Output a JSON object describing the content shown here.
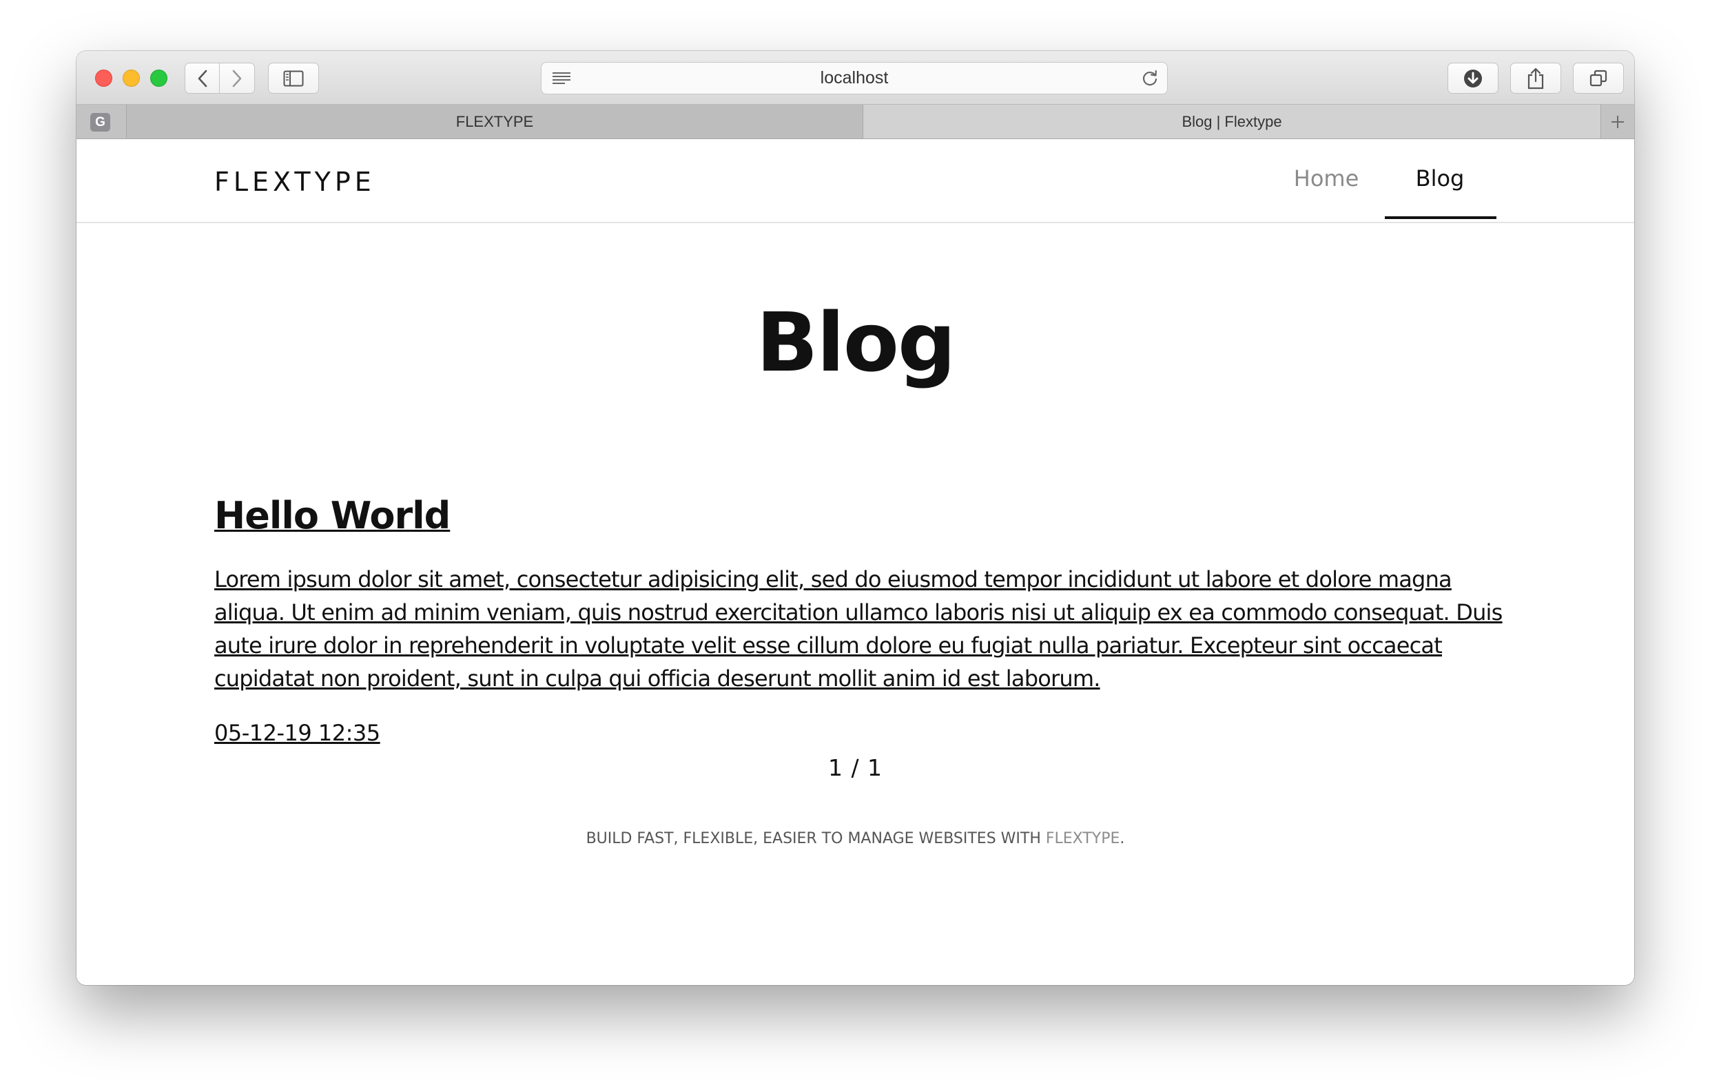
{
  "browser": {
    "url": "localhost",
    "tabs": [
      {
        "label": "FLEXTYPE",
        "favicon": "G"
      },
      {
        "label": "Blog | Flextype"
      }
    ]
  },
  "site": {
    "brand": "FLEXTYPE",
    "nav": [
      {
        "label": "Home"
      },
      {
        "label": "Blog"
      }
    ]
  },
  "page": {
    "title": "Blog",
    "post": {
      "title": "Hello World",
      "excerpt": "Lorem ipsum dolor sit amet, consectetur adipisicing elit, sed do eiusmod tempor incididunt ut labore et dolore magna aliqua. Ut enim ad minim veniam, quis nostrud exercitation ullamco laboris nisi ut aliquip ex ea commodo consequat. Duis aute irure dolor in reprehenderit in voluptate velit esse cillum dolore eu fugiat nulla pariatur. Excepteur sint occaecat cupidatat non proident, sunt in culpa qui officia deserunt mollit anim id est laborum.",
      "date": "05-12-19 12:35"
    },
    "pagination": "1 / 1"
  },
  "footer": {
    "text": "BUILD FAST, FLEXIBLE, EASIER TO MANAGE WEBSITES WITH ",
    "link": "FLEXTYPE",
    "suffix": "."
  }
}
